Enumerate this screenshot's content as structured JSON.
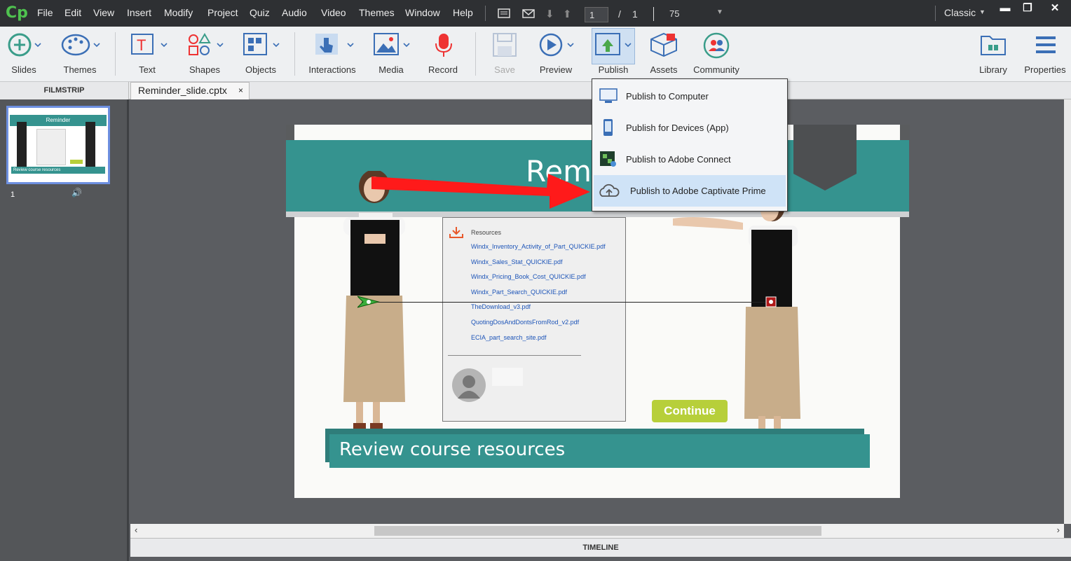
{
  "app": {
    "logo": "Cp"
  },
  "menubar": {
    "items": [
      "File",
      "Edit",
      "View",
      "Insert",
      "Modify",
      "Project",
      "Quiz",
      "Audio",
      "Video",
      "Themes",
      "Window",
      "Help"
    ],
    "slide_current": "1",
    "slide_separator": "/",
    "slide_total": "1",
    "zoom": "75",
    "workspace": "Classic"
  },
  "toolbar": {
    "slides": "Slides",
    "themes": "Themes",
    "text": "Text",
    "shapes": "Shapes",
    "objects": "Objects",
    "interactions": "Interactions",
    "media": "Media",
    "record": "Record",
    "save": "Save",
    "preview": "Preview",
    "publish": "Publish",
    "assets": "Assets",
    "community": "Community",
    "library": "Library",
    "properties": "Properties"
  },
  "filmstrip": {
    "header": "FILMSTRIP",
    "slide_number": "1",
    "thumb_title": "Reminder",
    "thumb_footer": "Review course resources"
  },
  "document_tab": {
    "name": "Reminder_slide.cptx",
    "close": "×"
  },
  "publish_menu": {
    "items": [
      "Publish to Computer",
      "Publish for Devices (App)",
      "Publish to Adobe Connect",
      "Publish to Adobe Captivate Prime"
    ],
    "highlighted_index": 3
  },
  "slide": {
    "title_partial": "Rem",
    "resources": {
      "heading": "Resources",
      "links": [
        "Windx_Inventory_Activity_of_Part_QUICKIE.pdf",
        "Windx_Sales_Stat_QUICKIE.pdf",
        "Windx_Pricing_Book_Cost_QUICKIE.pdf",
        "Windx_Part_Search_QUICKIE.pdf",
        "TheDownload_v3.pdf",
        "QuotingDosAndDontsFromRod_v2.pdf",
        "ECIA_part_search_site.pdf"
      ]
    },
    "continue_button": "Continue",
    "banner": "Review course resources"
  },
  "timeline": {
    "label": "TIMELINE"
  },
  "colors": {
    "teal": "#35938f",
    "accent_red": "#ff1a1a",
    "continue_green": "#b7cf3a",
    "menu_highlight": "#cfe3f7"
  }
}
